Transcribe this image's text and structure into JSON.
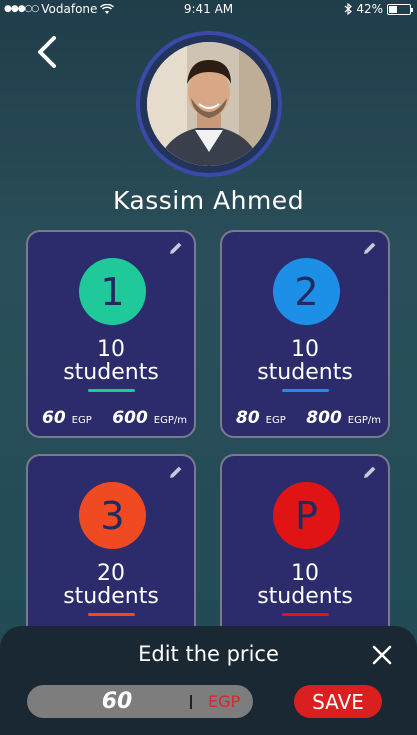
{
  "status_bar": {
    "carrier": "Vodafone",
    "time": "9:41 AM",
    "battery": "42%",
    "battery_level": 0.42
  },
  "profile": {
    "name": "Kassim Ahmed"
  },
  "cards": [
    {
      "badge": "1",
      "count": "10",
      "unit": "students",
      "color": "#1fc99a",
      "bar_color": "#1fc99a",
      "price": "60",
      "price_unit": "EGP",
      "monthly": "600",
      "monthly_unit": "EGP/m"
    },
    {
      "badge": "2",
      "count": "10",
      "unit": "students",
      "color": "#1e8fe6",
      "bar_color": "#1e8fe6",
      "price": "80",
      "price_unit": "EGP",
      "monthly": "800",
      "monthly_unit": "EGP/m"
    },
    {
      "badge": "3",
      "count": "20",
      "unit": "students",
      "color": "#f04a22",
      "bar_color": "#f04a22",
      "price": "",
      "price_unit": "",
      "monthly": "",
      "monthly_unit": ""
    },
    {
      "badge": "P",
      "count": "10",
      "unit": "students",
      "color": "#e01414",
      "bar_color": "#e01414",
      "price": "",
      "price_unit": "",
      "monthly": "",
      "monthly_unit": ""
    }
  ],
  "edit_sheet": {
    "title": "Edit the price",
    "value": "60",
    "currency": "EGP",
    "save_label": "SAVE"
  }
}
